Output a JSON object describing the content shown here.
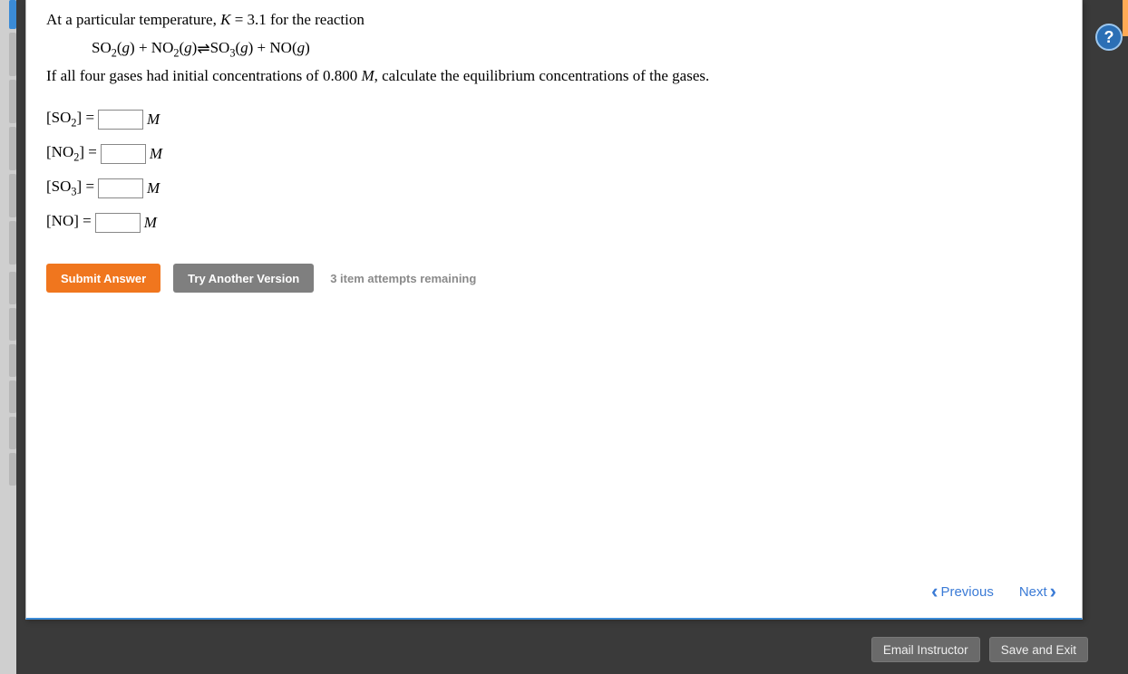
{
  "problem": {
    "intro_prefix": "At a particular temperature, ",
    "K_label": "K",
    "K_equals": " = ",
    "K_value": "3.1",
    "intro_suffix": " for the reaction",
    "reaction": {
      "SO2": "SO",
      "SO2_sub": "2",
      "g1": "g",
      "plus1": " + ",
      "NO2": "NO",
      "NO2_sub": "2",
      "g2": "g",
      "arrows": " ⇌ ",
      "SO3": "SO",
      "SO3_sub": "3",
      "g3": "g",
      "plus2": " + ",
      "NO": "NO",
      "g4": "g"
    },
    "body_prefix": "If all four gases had initial concentrations of ",
    "init_conc": "0.800",
    "M_unit": "M",
    "body_suffix": ", calculate the equilibrium concentrations of the gases."
  },
  "answers": [
    {
      "species_pre": "[SO",
      "sub": "2",
      "species_post": "] = ",
      "value": "",
      "unit": "M"
    },
    {
      "species_pre": "[NO",
      "sub": "2",
      "species_post": "] = ",
      "value": "",
      "unit": "M"
    },
    {
      "species_pre": "[SO",
      "sub": "3",
      "species_post": "] = ",
      "value": "",
      "unit": "M"
    },
    {
      "species_pre": "[NO",
      "sub": "",
      "species_post": "] = ",
      "value": "",
      "unit": "M"
    }
  ],
  "buttons": {
    "submit": "Submit Answer",
    "try_another": "Try Another Version",
    "attempts": "3 item attempts remaining"
  },
  "nav": {
    "previous": "Previous",
    "next": "Next"
  },
  "footer": {
    "email": "Email Instructor",
    "save_exit": "Save and Exit"
  },
  "help": "?"
}
